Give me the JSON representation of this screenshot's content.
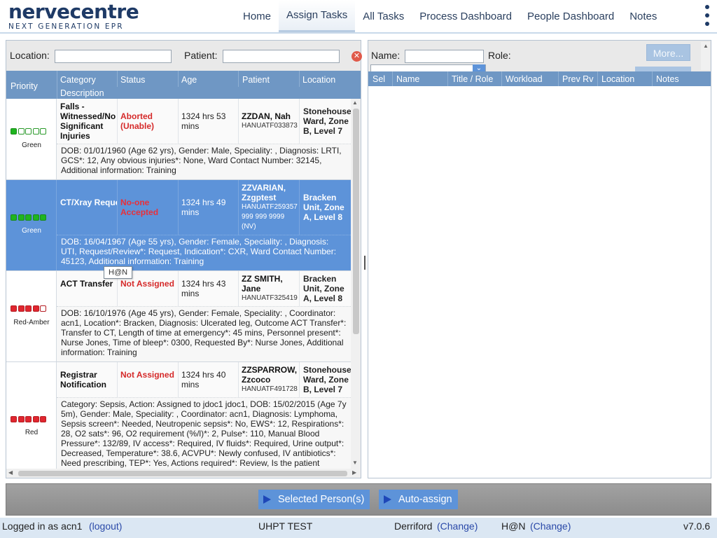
{
  "logo": {
    "word": "nervecentre",
    "subtitle": "NEXT GENERATION EPR"
  },
  "nav": {
    "items": [
      "Home",
      "Assign Tasks",
      "All Tasks",
      "Process Dashboard",
      "People Dashboard",
      "Notes"
    ],
    "active": "Assign Tasks"
  },
  "task_panel": {
    "location_label": "Location:",
    "location_value": "",
    "patient_label": "Patient:",
    "patient_value": "",
    "columns": {
      "priority": "Priority",
      "category": "Category",
      "status": "Status",
      "age": "Age",
      "patient": "Patient",
      "location": "Location",
      "description": "Description"
    },
    "tasks": [
      {
        "category": "Falls - Witnessed/No Significant Injuries",
        "status": "Aborted (Unable)",
        "age": "1324 hrs 53 mins",
        "patient_name": "ZZDAN, Nah",
        "patient_id": "HANUATF033873",
        "location": "Stonehouse Ward, Zone B, Level 7",
        "priority_label": "Green",
        "priority_level": 1,
        "description": "DOB: 01/01/1960 (Age 62 yrs), Gender: Male, Speciality: , Diagnosis: LRTI, GCS*: 12, Any obvious injuries*: None, Ward Contact Number: 32145, Additional information: Training"
      },
      {
        "category": "CT/Xray Request/Review",
        "status": "No-one Accepted",
        "age": "1324 hrs 49 mins",
        "patient_name": "ZZVARIAN, Zzgptest",
        "patient_id": "HANUATF259357",
        "patient_nhs": "999 999 9999",
        "patient_flag": "(NV)",
        "location": "Bracken Unit, Zone A, Level 8",
        "priority_label": "Green",
        "priority_level": 1,
        "description": "DOB: 16/04/1967 (Age 55 yrs), Gender: Female, Speciality: , Diagnosis: UTI, Request/Review*: Request, Indication*: CXR, Ward Contact Number: 45123, Additional information: Training"
      },
      {
        "category": "ACT Transfer",
        "status": "Not Assigned",
        "age": "1324 hrs 43 mins",
        "patient_name": "ZZ SMITH, Jane",
        "patient_id": "HANUATF325419",
        "location": "Bracken Unit, Zone A, Level 8",
        "priority_label": "Red-Amber",
        "priority_level": 4,
        "description": "DOB: 16/10/1976 (Age 45 yrs), Gender: Female, Speciality: , Coordinator: acn1, Location*: Bracken, Diagnosis: Ulcerated leg, Outcome ACT Transfer*: Transfer to CT, Length of time at emergency*: 45 mins, Personnel present*: Nurse Jones, Time of bleep*: 0300, Requested By*: Nurse Jones, Additional information: Training"
      },
      {
        "category": "Registrar Notification",
        "status": "Not Assigned",
        "age": "1324 hrs 40 mins",
        "patient_name": "ZZSPARROW, Zzcoco",
        "patient_id": "HANUATF491728",
        "location": "Stonehouse Ward, Zone B, Level 7",
        "priority_label": "Red",
        "priority_level": 5,
        "description": "Category: Sepsis, Action: Assigned to jdoc1 jdoc1, DOB: 15/02/2015 (Age 7y 5m), Gender: Male, Speciality: , Coordinator: acn1, Diagnosis: Lymphoma, Sepsis screen*: Needed, Neutropenic sepsis*: No, EWS*: 12, Respirations*: 28, O2 sats*: 96, O2 requirement (%/l)*: 2, Pulse*: 110, Manual Blood Pressure*: 132/89, IV access*: Required, IV fluids*: Required, Urine output*: Decreased, Temperature*: 38.6, ACVPU*: Newly confused, IV antibiotics*: Need prescribing, TEP*: Yes, Actions required*: Review, Is the patient"
      }
    ],
    "tooltip": "H@N"
  },
  "people_panel": {
    "name_label": "Name:",
    "name_value": "",
    "role_label": "Role:",
    "more_label": "More...",
    "columns": [
      "Sel",
      "Name",
      "Title / Role",
      "Workload",
      "Prev Rv",
      "Location",
      "Notes"
    ]
  },
  "actions": {
    "selected_persons": "Selected Person(s)",
    "auto_assign": "Auto-assign"
  },
  "status_bar": {
    "logged_in": "Logged in as acn1",
    "logout": "(logout)",
    "environment": "UHPT TEST",
    "site": "Derriford",
    "site_change": "(Change)",
    "shift": "H@N",
    "shift_change": "(Change)",
    "version": "v7.0.6"
  },
  "colors": {
    "brand_navy": "#1e3a66",
    "header_blue": "#6f97c4",
    "selected_row": "#5d93d9",
    "status_red": "#d52a2a",
    "priority_green": "#1fb51f",
    "priority_red": "#e0262f"
  }
}
